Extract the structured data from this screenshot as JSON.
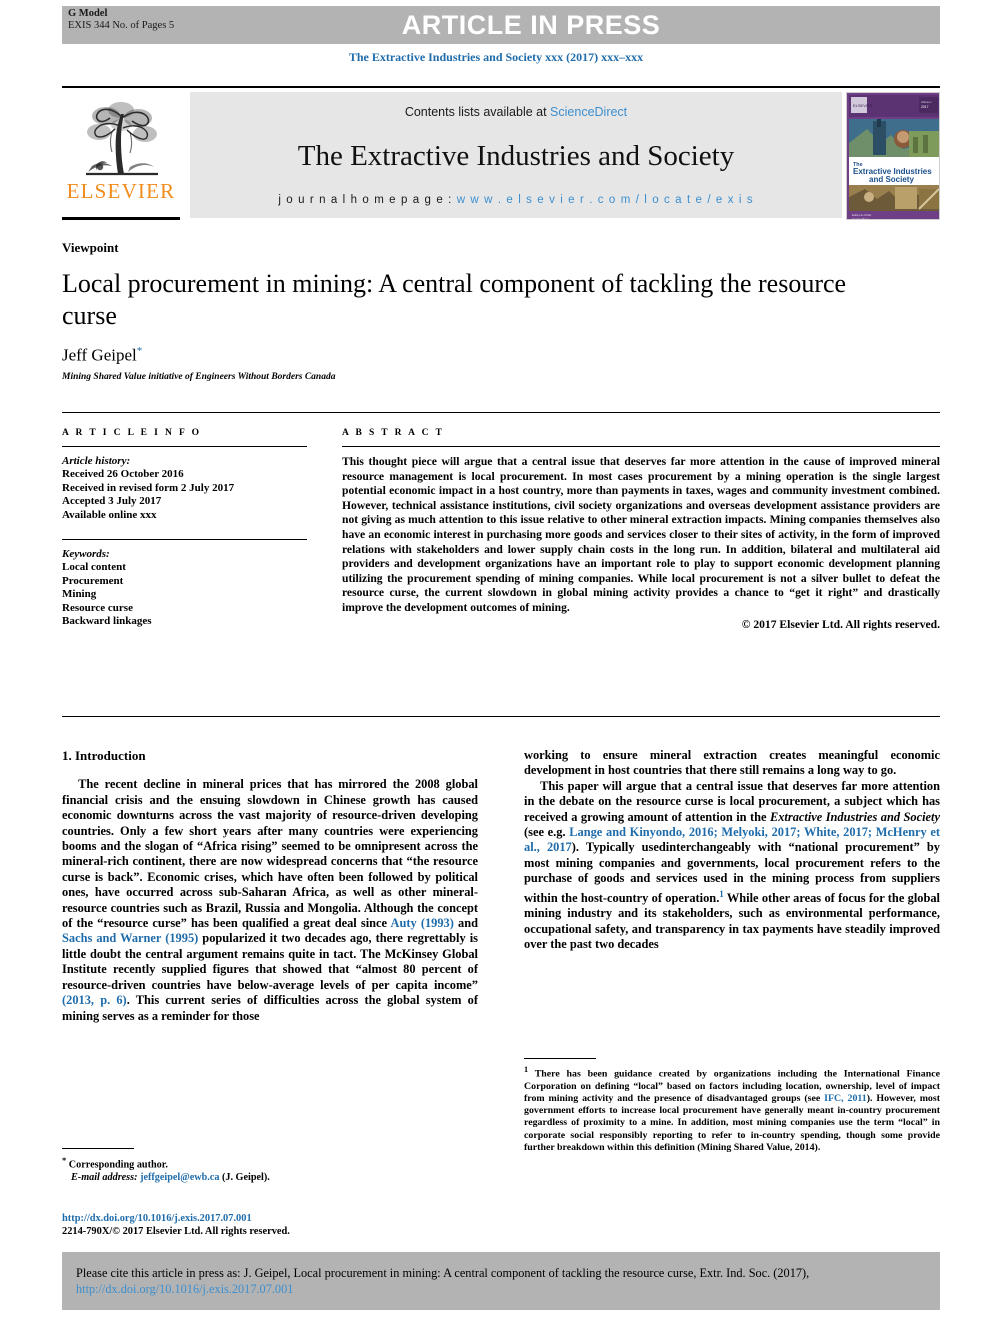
{
  "banner": {
    "g_model": "G Model",
    "model_id": "EXIS 344 No. of Pages 5",
    "title": "ARTICLE IN PRESS"
  },
  "journal_line": "The Extractive Industries and Society xxx (2017) xxx–xxx",
  "masthead": {
    "publisher": "ELSEVIER",
    "contents_prefix": "Contents lists available at ",
    "contents_link": "ScienceDirect",
    "journal_name": "The Extractive Industries and Society",
    "homepage_label": "j o u r n a l    h o m e p a g e :  ",
    "homepage_url": "w w w . e l s e v i e r . c o m / l o c a t e / e x i s",
    "cover_title_line1": "The",
    "cover_title_line2": "Extractive Industries",
    "cover_title_line3": "and Society"
  },
  "article": {
    "type": "Viewpoint",
    "title": "Local procurement in mining: A central component of tackling the resource curse",
    "author": "Jeff Geipel",
    "author_marker": "*",
    "affiliation": "Mining Shared Value initiative of Engineers Without Borders Canada"
  },
  "info": {
    "heading": "A R T I C L E   I N F O",
    "history_label": "Article history:",
    "history": [
      "Received 26 October 2016",
      "Received in revised form 2 July 2017",
      "Accepted 3 July 2017",
      "Available online xxx"
    ],
    "keywords_label": "Keywords:",
    "keywords": [
      "Local content",
      "Procurement",
      "Mining",
      "Resource curse",
      "Backward linkages"
    ]
  },
  "abstract": {
    "heading": "A B S T R A C T",
    "text": "This thought piece will argue that a central issue that deserves far more attention in the cause of improved mineral resource management is local procurement. In most cases procurement by a mining operation is the single largest potential economic impact in a host country, more than payments in taxes, wages and community investment combined. However, technical assistance institutions, civil society organizations and overseas development assistance providers are not giving as much attention to this issue relative to other mineral extraction impacts. Mining companies themselves also have an economic interest in purchasing more goods and services closer to their sites of activity, in the form of improved relations with stakeholders and lower supply chain costs in the long run. In addition, bilateral and multilateral aid providers and development organizations have an important role to play to support economic development planning utilizing the procurement spending of mining companies. While local procurement is not a silver bullet to defeat the resource curse, the current slowdown in global mining activity provides a chance to “get it right” and drastically improve the development outcomes of mining.",
    "copyright": "© 2017 Elsevier Ltd. All rights reserved."
  },
  "body": {
    "section_heading": "1. Introduction",
    "left_para_1_a": "The recent decline in mineral prices that has mirrored the 2008 global financial crisis and the ensuing slowdown in Chinese growth has caused economic downturns across the vast majority of resource-driven developing countries. Only a few short years after many countries were experiencing booms and the slogan of “Africa rising” seemed to be omnipresent across the mineral-rich continent, there are now widespread concerns that “the resource curse is back”. Economic crises, which have often been followed by political ones, have occurred across sub-Saharan Africa, as well as other mineral-resource countries such as Brazil, Russia and Mongolia. Although the concept of the “resource curse” has been qualified a great deal since ",
    "left_ref_1": "Auty (1993)",
    "left_para_1_b": " and ",
    "left_ref_2": "Sachs and Warner (1995)",
    "left_para_1_c": " popularized it two decades ago, there regrettably is little doubt the central argument remains quite in tact. The McKinsey Global Institute recently supplied figures that showed that “almost 80 percent of resource-driven countries have below-average levels of per capita income” ",
    "left_ref_3": "(2013, p. 6)",
    "left_para_1_d": ". This current series of difficulties across the global system of mining serves as a reminder for those",
    "right_para_1": "working to ensure mineral extraction creates meaningful economic development in host countries that there still remains a long way to go.",
    "right_para_2_a": "This paper will argue that a central issue that deserves far more attention in the debate on the resource curse is local procurement, a subject which has received a growing amount of attention in the ",
    "right_italic_1": "Extractive Industries and Society",
    "right_para_2_b": " (see e.g. ",
    "right_ref_1": "Lange and Kinyondo, 2016; Melyoki, 2017; White, 2017; McHenry et al., 2017",
    "right_para_2_c": "). Typically usedinterchangeably with “national procurement” by most mining companies and governments, local procurement refers to the purchase of goods and services used in the mining process from suppliers within the host-country of operation.",
    "right_footnote_marker": "1",
    "right_para_2_d": " While other areas of focus for the global mining industry and its stakeholders, such as environmental performance, occupational safety, and transparency in tax payments have steadily improved over the past two decades"
  },
  "footnotes": {
    "corresponding_marker": "*",
    "corresponding_label": "Corresponding author.",
    "email_label": "E-mail address:",
    "email": "jeffgeipel@ewb.ca",
    "email_suffix": "(J. Geipel).",
    "doi_url": "http://dx.doi.org/10.1016/j.exis.2017.07.001",
    "issn_line": "2214-790X/© 2017 Elsevier Ltd. All rights reserved.",
    "note1_marker": "1",
    "note1_a": "There has been guidance created by organizations including the International Finance Corporation on defining “local” based on factors including location, ownership, level of impact from mining activity and the presence of disadvantaged groups (see ",
    "note1_ref": "IFC, 2011",
    "note1_b": "). However, most government efforts to increase local procurement have generally meant in-country procurement regardless of proximity to a mine. In addition, most mining companies use the term “local” in corporate social responsibly reporting to refer to in-country spending, though some provide further breakdown within this definition (Mining Shared Value, 2014)."
  },
  "cite_box": {
    "text_a": "Please cite this article in press as: J. Geipel, Local procurement in mining: A central component of tackling the resource curse, Extr. Ind. Soc. (2017), ",
    "link": "http://dx.doi.org/10.1016/j.exis.2017.07.001"
  },
  "colors": {
    "link_blue": "#1f6cab",
    "masthead_link": "#3c8fd0",
    "elsevier_orange": "#f08c1e",
    "banner_gray": "#b3b3b3",
    "masthead_gray": "#e6e6e6"
  }
}
